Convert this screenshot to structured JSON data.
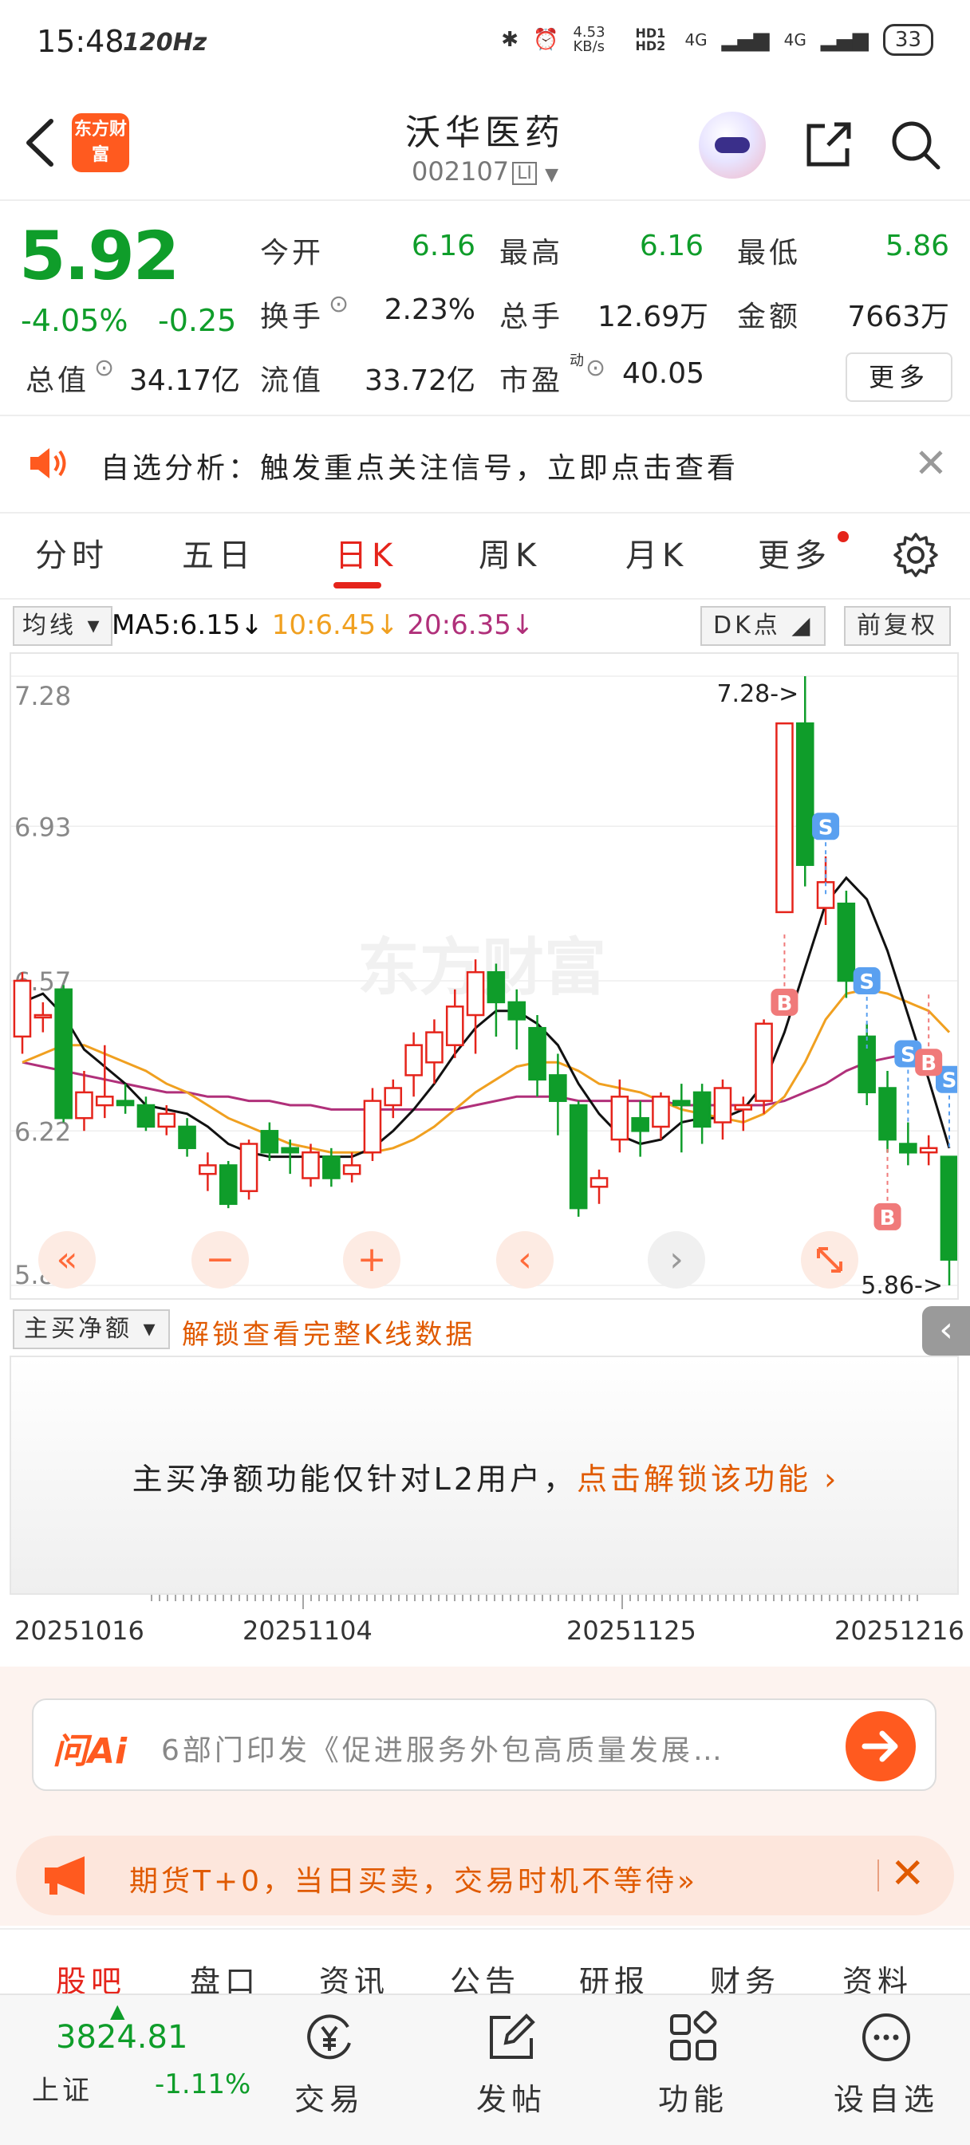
{
  "status_bar": {
    "time": "15:48",
    "hz": "120Hz",
    "net_speed": "4.53 KB/s",
    "hd": "HD1 HD2",
    "net1": "4G",
    "net2": "4G",
    "battery": "33"
  },
  "header": {
    "logo_text": "东方财富",
    "stock_name": "沃华医药",
    "stock_code": "002107",
    "code_tag": "LI"
  },
  "quote": {
    "price": "5.92",
    "change_pct": "-4.05%",
    "change_amt": "-0.25",
    "open_label": "今开",
    "open": "6.16",
    "high_label": "最高",
    "high": "6.16",
    "low_label": "最低",
    "low": "5.86",
    "turnover_label": "换手",
    "turnover": "2.23%",
    "volume_label": "总手",
    "volume": "12.69万",
    "amount_label": "金额",
    "amount": "7663万",
    "mcap_label": "总值",
    "mcap": "34.17亿",
    "float_label": "流值",
    "float_mcap": "33.72亿",
    "pe_label": "市盈",
    "pe_sup": "动",
    "pe": "40.05",
    "more_label": "更多"
  },
  "notice": {
    "text": "自选分析：触发重点关注信号，立即点击查看"
  },
  "tabs": {
    "items": [
      "分时",
      "五日",
      "日K",
      "周K",
      "月K",
      "更多"
    ],
    "active": "日K"
  },
  "ma_bar": {
    "select_label": "均线",
    "ma5": "MA5:6.15",
    "ma10": "10:6.45",
    "ma20": "20:6.35",
    "dk_label": "DK点",
    "fq_label": "前复权"
  },
  "chart_data": {
    "type": "candlestick",
    "y_ticks": [
      "7.28",
      "6.93",
      "6.57",
      "6.22",
      "5.86"
    ],
    "ylim": [
      5.86,
      7.28
    ],
    "max_label": "7.28->",
    "min_label": "5.86->",
    "watermark": "东方财富",
    "x_ticks": [
      "20251016",
      "20251104",
      "20251125",
      "20251216"
    ],
    "candles": [
      {
        "o": 6.44,
        "c": 6.57,
        "h": 6.59,
        "l": 6.4
      },
      {
        "o": 6.49,
        "c": 6.49,
        "h": 6.52,
        "l": 6.45
      },
      {
        "o": 6.55,
        "c": 6.25,
        "h": 6.56,
        "l": 6.24
      },
      {
        "o": 6.25,
        "c": 6.31,
        "h": 6.36,
        "l": 6.22
      },
      {
        "o": 6.28,
        "c": 6.3,
        "h": 6.42,
        "l": 6.25
      },
      {
        "o": 6.29,
        "c": 6.28,
        "h": 6.33,
        "l": 6.26
      },
      {
        "o": 6.28,
        "c": 6.23,
        "h": 6.3,
        "l": 6.22
      },
      {
        "o": 6.23,
        "c": 6.26,
        "h": 6.28,
        "l": 6.21
      },
      {
        "o": 6.23,
        "c": 6.18,
        "h": 6.25,
        "l": 6.16
      },
      {
        "o": 6.12,
        "c": 6.14,
        "h": 6.17,
        "l": 6.08
      },
      {
        "o": 6.14,
        "c": 6.05,
        "h": 6.15,
        "l": 6.04
      },
      {
        "o": 6.08,
        "c": 6.19,
        "h": 6.2,
        "l": 6.06
      },
      {
        "o": 6.22,
        "c": 6.17,
        "h": 6.24,
        "l": 6.15
      },
      {
        "o": 6.18,
        "c": 6.17,
        "h": 6.2,
        "l": 6.12
      },
      {
        "o": 6.11,
        "c": 6.17,
        "h": 6.19,
        "l": 6.09
      },
      {
        "o": 6.16,
        "c": 6.11,
        "h": 6.18,
        "l": 6.09
      },
      {
        "o": 6.12,
        "c": 6.14,
        "h": 6.17,
        "l": 6.1
      },
      {
        "o": 6.17,
        "c": 6.29,
        "h": 6.32,
        "l": 6.15
      },
      {
        "o": 6.28,
        "c": 6.32,
        "h": 6.34,
        "l": 6.25
      },
      {
        "o": 6.35,
        "c": 6.42,
        "h": 6.45,
        "l": 6.3
      },
      {
        "o": 6.38,
        "c": 6.45,
        "h": 6.48,
        "l": 6.33
      },
      {
        "o": 6.42,
        "c": 6.51,
        "h": 6.55,
        "l": 6.39
      },
      {
        "o": 6.49,
        "c": 6.59,
        "h": 6.62,
        "l": 6.4
      },
      {
        "o": 6.59,
        "c": 6.52,
        "h": 6.61,
        "l": 6.44
      },
      {
        "o": 6.52,
        "c": 6.48,
        "h": 6.55,
        "l": 6.41
      },
      {
        "o": 6.46,
        "c": 6.34,
        "h": 6.49,
        "l": 6.3
      },
      {
        "o": 6.35,
        "c": 6.29,
        "h": 6.4,
        "l": 6.21
      },
      {
        "o": 6.28,
        "c": 6.04,
        "h": 6.29,
        "l": 6.02
      },
      {
        "o": 6.09,
        "c": 6.11,
        "h": 6.13,
        "l": 6.05
      },
      {
        "o": 6.2,
        "c": 6.3,
        "h": 6.34,
        "l": 6.17
      },
      {
        "o": 6.25,
        "c": 6.22,
        "h": 6.29,
        "l": 6.16
      },
      {
        "o": 6.23,
        "c": 6.3,
        "h": 6.31,
        "l": 6.2
      },
      {
        "o": 6.29,
        "c": 6.28,
        "h": 6.33,
        "l": 6.17
      },
      {
        "o": 6.31,
        "c": 6.23,
        "h": 6.33,
        "l": 6.19
      },
      {
        "o": 6.24,
        "c": 6.32,
        "h": 6.34,
        "l": 6.2
      },
      {
        "o": 6.27,
        "c": 6.28,
        "h": 6.3,
        "l": 6.22
      },
      {
        "o": 6.29,
        "c": 6.47,
        "h": 6.48,
        "l": 6.26
      },
      {
        "o": 6.73,
        "c": 7.17,
        "h": 7.17,
        "l": 6.73
      },
      {
        "o": 7.17,
        "c": 6.84,
        "h": 7.28,
        "l": 6.79
      },
      {
        "o": 6.74,
        "c": 6.8,
        "h": 6.86,
        "l": 6.7
      },
      {
        "o": 6.75,
        "c": 6.57,
        "h": 6.78,
        "l": 6.53
      },
      {
        "o": 6.44,
        "c": 6.31,
        "h": 6.47,
        "l": 6.28
      },
      {
        "o": 6.32,
        "c": 6.2,
        "h": 6.36,
        "l": 6.17
      },
      {
        "o": 6.19,
        "c": 6.17,
        "h": 6.24,
        "l": 6.14
      },
      {
        "o": 6.17,
        "c": 6.18,
        "h": 6.21,
        "l": 6.14
      },
      {
        "o": 6.16,
        "c": 5.92,
        "h": 6.16,
        "l": 5.86
      }
    ],
    "ma5": [
      6.52,
      6.54,
      6.49,
      6.41,
      6.37,
      6.33,
      6.28,
      6.27,
      6.26,
      6.23,
      6.19,
      6.17,
      6.16,
      6.16,
      6.16,
      6.16,
      6.16,
      6.18,
      6.22,
      6.27,
      6.33,
      6.4,
      6.46,
      6.5,
      6.5,
      6.47,
      6.42,
      6.33,
      6.26,
      6.21,
      6.19,
      6.2,
      6.24,
      6.25,
      6.25,
      6.27,
      6.33,
      6.45,
      6.6,
      6.75,
      6.81,
      6.76,
      6.64,
      6.49,
      6.34,
      6.18
    ],
    "ma10": [
      6.38,
      6.4,
      6.42,
      6.42,
      6.4,
      6.38,
      6.36,
      6.33,
      6.31,
      6.28,
      6.25,
      6.23,
      6.21,
      6.19,
      6.18,
      6.17,
      6.17,
      6.17,
      6.18,
      6.2,
      6.23,
      6.27,
      6.31,
      6.34,
      6.37,
      6.38,
      6.38,
      6.36,
      6.33,
      6.32,
      6.31,
      6.29,
      6.27,
      6.26,
      6.25,
      6.24,
      6.26,
      6.3,
      6.38,
      6.48,
      6.54,
      6.55,
      6.54,
      6.52,
      6.5,
      6.45
    ],
    "ma20": [
      6.38,
      6.37,
      6.36,
      6.35,
      6.34,
      6.33,
      6.32,
      6.31,
      6.31,
      6.3,
      6.3,
      6.29,
      6.29,
      6.28,
      6.28,
      6.27,
      6.27,
      6.27,
      6.27,
      6.27,
      6.27,
      6.27,
      6.28,
      6.29,
      6.3,
      6.3,
      6.3,
      6.29,
      6.29,
      6.29,
      6.29,
      6.29,
      6.28,
      6.28,
      6.28,
      6.28,
      6.28,
      6.29,
      6.31,
      6.33,
      6.36,
      6.38,
      6.39,
      6.4,
      6.4,
      6.35
    ],
    "signals": [
      {
        "label": "S",
        "index": 39,
        "price": 6.93
      },
      {
        "label": "S",
        "index": 41,
        "price": 6.57
      },
      {
        "label": "S",
        "index": 43,
        "price": 6.4
      },
      {
        "label": "S",
        "index": 45,
        "price": 6.34
      },
      {
        "label": "B",
        "index": 37,
        "price": 6.52
      },
      {
        "label": "B",
        "index": 42,
        "price": 6.02
      },
      {
        "label": "B",
        "index": 44,
        "price": 6.38
      }
    ]
  },
  "chart_controls": {
    "rewind": "«",
    "zoom_out": "−",
    "zoom_in": "+",
    "prev": "‹",
    "next": "›"
  },
  "sub_panel": {
    "select_label": "主买净额",
    "unlock_link": "解锁查看完整K线数据",
    "l2_text": "主买净额功能仅针对L2用户，",
    "l2_link": "点击解锁该功能 ›"
  },
  "ai": {
    "logo": "问Ai",
    "text": "6部门印发《促进服务外包高质量发展…"
  },
  "promo": {
    "text": "期货T+0，当日买卖，交易时机不等待»"
  },
  "sub_nav": [
    "股吧",
    "盘口",
    "资讯",
    "公告",
    "研报",
    "财务",
    "资料"
  ],
  "bottom_bar": {
    "index_value": "3824.81",
    "index_name": "上证",
    "index_pct": "-1.11%",
    "trade": "交易",
    "post": "发帖",
    "features": "功能",
    "watch": "设自选"
  },
  "colors": {
    "up": "#e5241b",
    "down": "#0f9d2a",
    "ma5": "#111111",
    "ma10": "#f0a020",
    "ma20": "#b0307a",
    "accent": "#ff5a1f"
  }
}
